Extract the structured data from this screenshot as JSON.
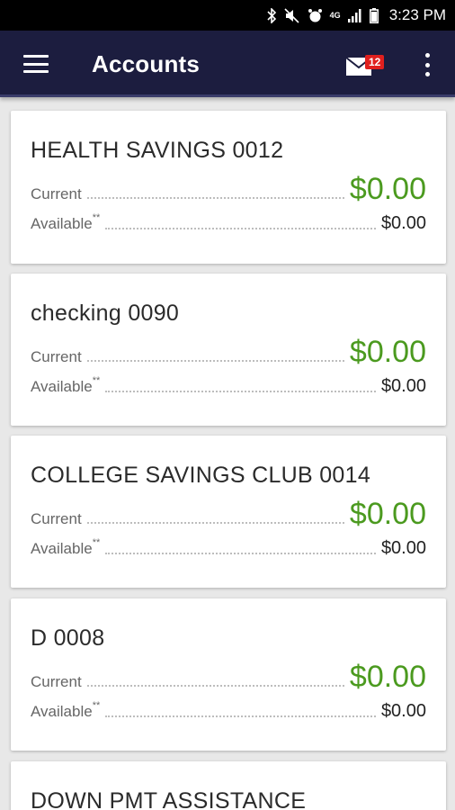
{
  "status_bar": {
    "network_label": "4G",
    "time": "3:23 PM"
  },
  "app_bar": {
    "title": "Accounts",
    "mail_badge_count": "12"
  },
  "accounts": [
    {
      "name": "HEALTH SAVINGS 0012",
      "current_label": "Current",
      "current_amount": "$0.00",
      "available_label": "Available",
      "available_mark": "**",
      "available_amount": "$0.00"
    },
    {
      "name": "checking 0090",
      "current_label": "Current",
      "current_amount": "$0.00",
      "available_label": "Available",
      "available_mark": "**",
      "available_amount": "$0.00"
    },
    {
      "name": "COLLEGE SAVINGS CLUB 0014",
      "current_label": "Current",
      "current_amount": "$0.00",
      "available_label": "Available",
      "available_mark": "**",
      "available_amount": "$0.00"
    },
    {
      "name": "D 0008",
      "current_label": "Current",
      "current_amount": "$0.00",
      "available_label": "Available",
      "available_mark": "**",
      "available_amount": "$0.00"
    },
    {
      "name": "DOWN PMT ASSISTANCE"
    }
  ],
  "colors": {
    "app_bar": "#1c1d3f",
    "current_amount": "#4b9a1f",
    "badge": "#e0201e"
  }
}
